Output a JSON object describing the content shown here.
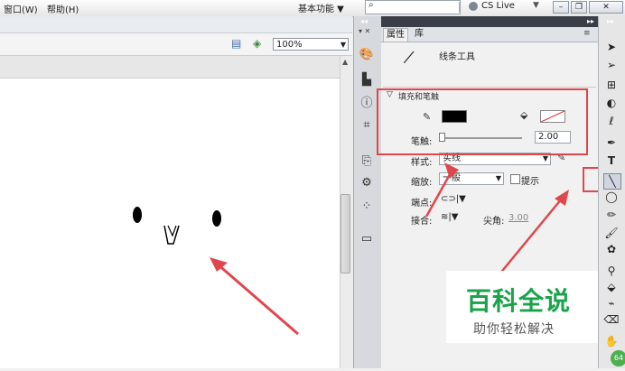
{
  "menubar": {
    "items": [
      "窗口(W)",
      "帮助(H)"
    ],
    "workspace": "基本功能 ▼",
    "cslive": "CS Live"
  },
  "stage": {
    "zoom": "100%"
  },
  "props": {
    "tabs": [
      "属性",
      "库"
    ],
    "tool_name": "线条工具",
    "section": "填充和笔触",
    "stroke_label": "笔触:",
    "stroke_value": "2.00",
    "style_label": "样式:",
    "style_value": "实线",
    "scale_label": "缩放:",
    "scale_value": "一般",
    "hint_label": "提示",
    "cap_label": "端点:",
    "join_label": "接合:",
    "miter_label": "尖角:",
    "miter_value": "3.00"
  },
  "watermark": {
    "title": "百科全说",
    "subtitle": "助你轻松解决"
  },
  "colors": {
    "accent_red": "#e0474c",
    "stroke_color": "#000000",
    "watermark_green": "#1aa34a"
  }
}
